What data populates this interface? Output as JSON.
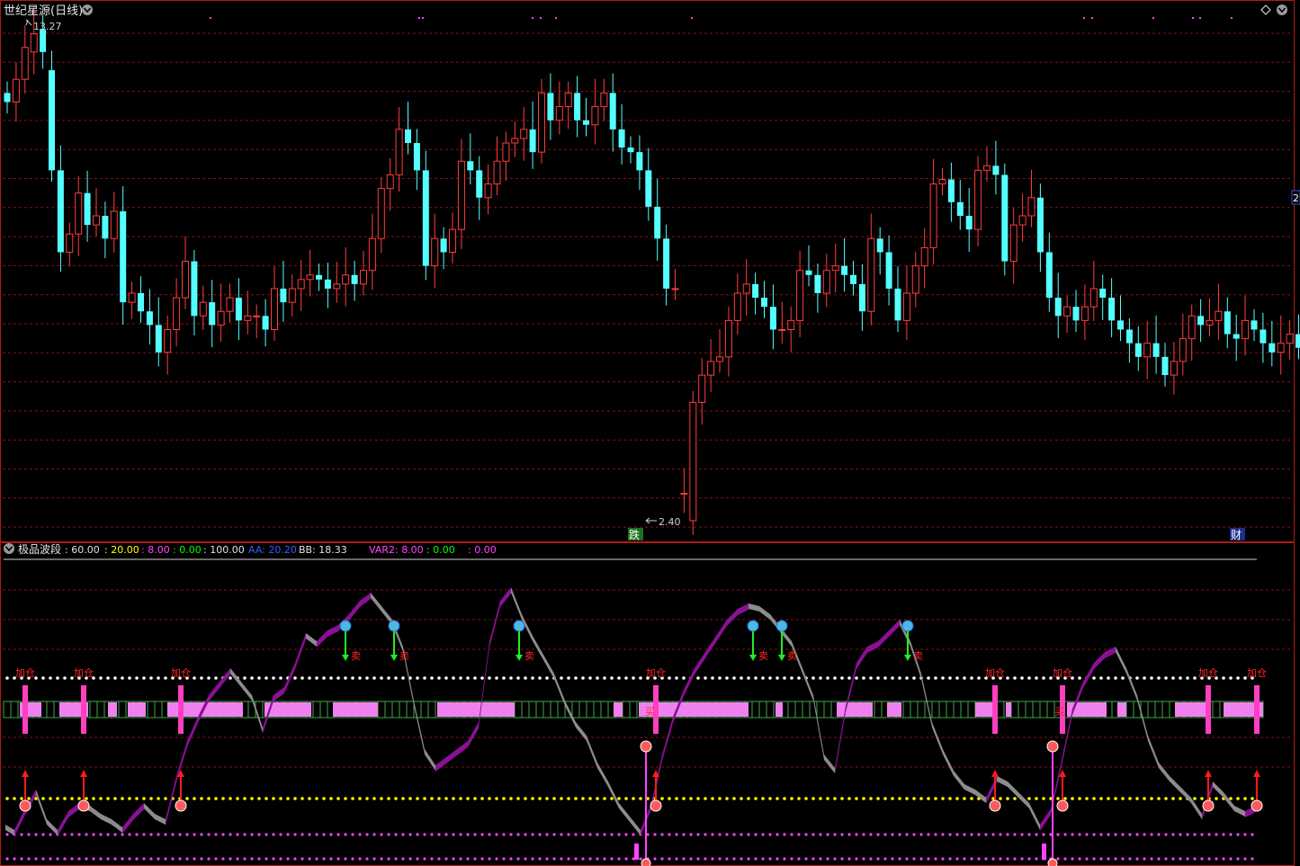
{
  "window": {
    "stock_title": "世纪星源",
    "period": "(日线)",
    "right_edge_label": "2"
  },
  "main_chart": {
    "high_label": "13.27",
    "low_label": "2.40",
    "markers": {
      "die": "跌",
      "cai": "财"
    }
  },
  "indicator": {
    "name": "极品波段",
    "params": [
      {
        "text": ": 60.00",
        "color": "#e0e0e0"
      },
      {
        "text": ": 20.00",
        "color": "#ffff00"
      },
      {
        "text": ": 8.00",
        "color": "#ff44ff"
      },
      {
        "text": ": 0.00",
        "color": "#00ff00"
      },
      {
        "text": ": 100.00",
        "color": "#e0e0e0"
      },
      {
        "text": "AA: 20.20",
        "color": "#3060ff"
      },
      {
        "text": "BB: 18.33",
        "color": "#e0e0e0"
      },
      {
        "text": "VAR2: 8.00",
        "color": "#ff44ff"
      },
      {
        "text": ": 0.00",
        "color": "#00ff00"
      },
      {
        "text": ": 0.00",
        "color": "#ff44ff"
      }
    ],
    "labels": {
      "jiacang": "加仓",
      "mai_sell": "卖",
      "mai_buy": "买"
    }
  },
  "colors": {
    "up": "#ff3c3c",
    "down": "#54ffff",
    "grid": "#8a1010",
    "border": "#b01818",
    "purple": "#8a1096",
    "gray": "#8c8c8c",
    "pink": "#f080f0",
    "magenta": "#ff3fc0"
  },
  "chart_data": {
    "type": "candlestick",
    "title": "世纪星源 (日线)",
    "price_labels": {
      "high": 13.27,
      "low": 2.4
    },
    "events": {
      "die": "跌",
      "cai": "财"
    },
    "indicator": {
      "name": "极品波段",
      "levels": [
        60,
        20,
        8,
        0,
        100
      ],
      "AA": 20.2,
      "BB": 18.33,
      "VAR2": 8.0
    }
  }
}
